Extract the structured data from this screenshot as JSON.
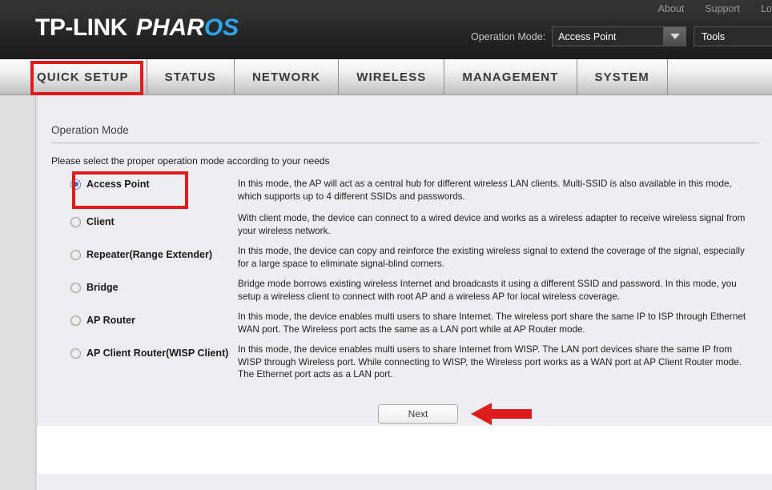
{
  "header": {
    "brand_main": "TP-LINK",
    "brand_sub_white": "PHAR",
    "brand_sub_blue": "OS",
    "links": [
      "About",
      "Support",
      "Lo"
    ],
    "operation_mode_label": "Operation Mode:",
    "operation_mode_value": "Access Point",
    "tools_value": "Tools",
    "accent_blue": "#2ba6e8"
  },
  "nav": {
    "tabs": [
      {
        "label": "QUICK SETUP",
        "active": true
      },
      {
        "label": "STATUS",
        "active": false
      },
      {
        "label": "NETWORK",
        "active": false
      },
      {
        "label": "WIRELESS",
        "active": false
      },
      {
        "label": "MANAGEMENT",
        "active": false
      },
      {
        "label": "SYSTEM",
        "active": false
      }
    ]
  },
  "panel": {
    "title": "Operation Mode",
    "intro": "Please select the proper operation mode according to your needs",
    "modes": [
      {
        "label": "Access Point",
        "selected": true,
        "description": "In this mode, the AP will act as a central hub for different wireless LAN clients. Multi-SSID is also available in this mode, which supports up to 4 different SSIDs and passwords."
      },
      {
        "label": "Client",
        "selected": false,
        "description": "With client mode, the device can connect to a wired device and works as a wireless adapter to receive wireless signal from your wireless network."
      },
      {
        "label": "Repeater(Range Extender)",
        "selected": false,
        "description": "In this mode, the device can copy and reinforce the existing wireless signal to extend the coverage of the signal, especially for a large space to eliminate signal-blind corners."
      },
      {
        "label": "Bridge",
        "selected": false,
        "description": "Bridge mode borrows existing wireless Internet and broadcasts it using a different SSID and password. In this mode, you setup a wireless client to connect with root AP and a wireless AP for local wireless coverage."
      },
      {
        "label": "AP Router",
        "selected": false,
        "description": "In this mode, the device enables multi users to share Internet. The wireless port share the same IP to ISP through Ethernet WAN port. The Wireless port acts the same as a LAN port while at AP Router mode."
      },
      {
        "label": "AP Client Router(WISP Client)",
        "selected": false,
        "description": "In this mode, the device enables multi users to share Internet from WISP. The LAN port devices share the same IP from WISP through Wireless port. While connecting to WISP, the Wireless port works as a WAN port at AP Client Router mode. The Ethernet port acts as a LAN port."
      }
    ],
    "next_label": "Next"
  },
  "annotations": {
    "highlight_color": "#e01b1b",
    "arrow_color": "#e01b1b",
    "highlighted_tab": "QUICK SETUP",
    "highlighted_mode": "Access Point"
  }
}
